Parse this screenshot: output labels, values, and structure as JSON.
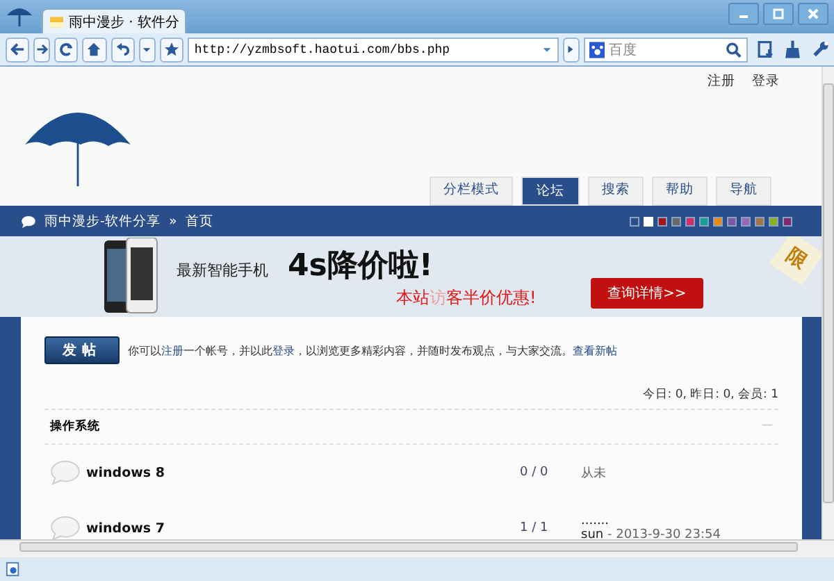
{
  "window": {
    "tab_title": "雨中漫步 · 软件分"
  },
  "toolbar": {
    "address": "http://yzmbsoft.haotui.com/bbs.php",
    "search_placeholder": "百度"
  },
  "top_links": [
    "注册",
    "登录"
  ],
  "nav_tabs": [
    {
      "label": "分栏模式",
      "selected": false
    },
    {
      "label": "论坛",
      "selected": true
    },
    {
      "label": "搜索",
      "selected": false
    },
    {
      "label": "帮助",
      "selected": false
    },
    {
      "label": "导航",
      "selected": false
    }
  ],
  "breadcrumb": [
    "雨中漫步-软件分享",
    "»",
    "首页"
  ],
  "theme_swatches": [
    {
      "color": "#2a4e8a",
      "selected": false
    },
    {
      "color": "#ffffff",
      "selected": true
    },
    {
      "color": "#a01818",
      "selected": false
    },
    {
      "color": "#6a6a6a",
      "selected": false
    },
    {
      "color": "#d0306a",
      "selected": false
    },
    {
      "color": "#18a098",
      "selected": false
    },
    {
      "color": "#e88a10",
      "selected": false
    },
    {
      "color": "#7a5aa8",
      "selected": false
    },
    {
      "color": "#9a6ab8",
      "selected": false
    },
    {
      "color": "#a07848",
      "selected": false
    },
    {
      "color": "#88b020",
      "selected": false
    },
    {
      "color": "#802870",
      "selected": false
    }
  ],
  "banner": {
    "subtitle": "最新智能手机",
    "headline": "4s降价啦!",
    "offer": [
      {
        "text": "本站",
        "faded": false
      },
      {
        "text": "访",
        "faded": true
      },
      {
        "text": "客半价优惠!",
        "faded": false
      }
    ],
    "button": "查询详情>>",
    "corner": "限"
  },
  "notice": {
    "post_button": "发帖",
    "parts": [
      {
        "kind": "text",
        "text": "你可以"
      },
      {
        "kind": "link",
        "text": "注册"
      },
      {
        "kind": "text",
        "text": "一个帐号，并以此"
      },
      {
        "kind": "link",
        "text": "登录"
      },
      {
        "kind": "text",
        "text": "，以浏览更多精彩内容，并随时发布观点，与大家交流。"
      },
      {
        "kind": "link",
        "text": "查看新帖"
      }
    ]
  },
  "stats": "今日: 0, 昨日: 0, 会员: 1",
  "category": {
    "title": "操作系统",
    "toggle": "—"
  },
  "forums": [
    {
      "name": "windows 8",
      "counts": "0 / 0",
      "last_text": "从未"
    },
    {
      "name": "windows 7",
      "counts": "1 / 1",
      "last_title": ".......",
      "last_author": "sun",
      "last_time": "- 2013-9-30 23:54"
    }
  ]
}
